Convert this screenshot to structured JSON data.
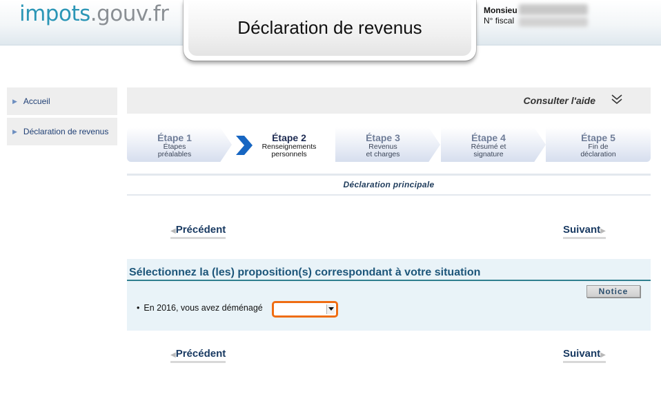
{
  "header": {
    "logo_part1": "impots",
    "logo_part2": ".gouv.fr",
    "title": "Déclaration de revenus",
    "user_salutation": "Monsieu",
    "fiscal_label": "N° fiscal"
  },
  "sidebar": {
    "items": [
      {
        "label": "Accueil"
      },
      {
        "label": "Déclaration de revenus"
      }
    ]
  },
  "help": {
    "label": "Consulter l'aide"
  },
  "steps": [
    {
      "title": "Étape 1",
      "line1": "Étapes",
      "line2": "préalables",
      "active": false
    },
    {
      "title": "Étape 2",
      "line1": "Renseignements",
      "line2": "personnels",
      "active": true
    },
    {
      "title": "Étape 3",
      "line1": "Revenus",
      "line2": "et charges",
      "active": false
    },
    {
      "title": "Étape 4",
      "line1": "Résumé et",
      "line2": "signature",
      "active": false
    },
    {
      "title": "Étape 5",
      "line1": "Fin de",
      "line2": "déclaration",
      "active": false
    }
  ],
  "declaration_section": "Déclaration principale",
  "nav": {
    "previous": "Précédent",
    "next": "Suivant"
  },
  "panel": {
    "title": "Sélectionnez la (les) proposition(s) correspondant à votre situation",
    "notice_button": "Notice",
    "question": "En 2016, vous avez déménagé",
    "select_value": ""
  },
  "colors": {
    "accent_blue": "#2b96b6",
    "link_navy": "#193a62",
    "highlight_orange": "#ef6d12",
    "panel_bg": "#e9f3f8"
  }
}
